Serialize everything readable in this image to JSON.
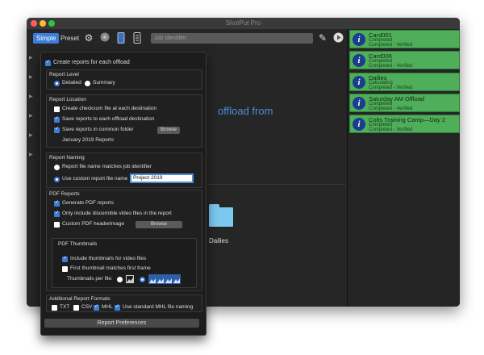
{
  "window": {
    "title": "ShotPut Pro"
  },
  "toolbar": {
    "simple_label": "Simple",
    "preset_label": "Preset",
    "job_identifier_placeholder": "Job Identifier"
  },
  "main": {
    "prompt_text": "offload from",
    "folder_label": "Dailies"
  },
  "queue": [
    {
      "title": "Card001",
      "status": "Completed",
      "detail": "Completed - Verified"
    },
    {
      "title": "Card008",
      "status": "Completed",
      "detail": "Completed - Verified"
    },
    {
      "title": "Dailies",
      "status": "Calculating",
      "detail": "Completed - Verified"
    },
    {
      "title": "Saturday AM Offload",
      "status": "Completed",
      "detail": "Completed - Verified"
    },
    {
      "title": "Colts Training Camp—Day 2",
      "status": "Completed",
      "detail": "Completed - Verified"
    }
  ],
  "prefs": {
    "create_reports": "Create reports for each offload",
    "report_level": {
      "heading": "Report Level",
      "detailed": "Detailed",
      "summary": "Summary"
    },
    "report_location": {
      "heading": "Report Location",
      "checksum": "Create checksum file at each destination",
      "save_each": "Save reports to each offload destination",
      "save_common": "Save reports in common folder",
      "browse": "Browse",
      "folder_name": "January 2019 Reports"
    },
    "report_naming": {
      "heading": "Report Naming",
      "matches_job": "Report file name matches job identifier",
      "use_custom": "Use custom report file name",
      "custom_value": "Project 2019"
    },
    "pdf_reports": {
      "heading": "PDF Reports",
      "generate": "Generate PDF reports",
      "only_video": "Only include discernible video files in the report",
      "custom_header": "Custom PDF header",
      "image": "Image",
      "browse": "Browse"
    },
    "pdf_thumbnails": {
      "heading": "PDF Thumbnails",
      "include": "Include thumbnails for video files",
      "first_match": "First thumbnail matches first frame",
      "per_file": "Thumbnails per file:"
    },
    "additional_formats": {
      "heading": "Additional Report Formats",
      "txt": "TXT",
      "csv": "CSV",
      "mhl": "MHL",
      "standard_mhl": "Use standard MHL file naming"
    },
    "footer_button": "Report Preferences"
  },
  "colors": {
    "accent": "#3b7dd8",
    "completed_card": "#4fae5a",
    "info_icon": "#1a3d8c"
  }
}
